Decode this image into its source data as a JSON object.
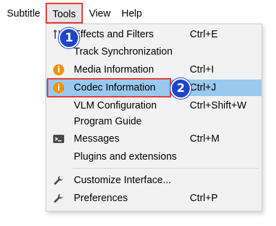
{
  "menubar": {
    "subtitle": "Subtitle",
    "tools": "Tools",
    "view": "View",
    "help": "Help"
  },
  "menu": {
    "effects": {
      "label": "Effects and Filters",
      "shortcut": "Ctrl+E"
    },
    "track_sync": {
      "label": "Track Synchronization"
    },
    "media_info": {
      "label": "Media Information",
      "shortcut": "Ctrl+I"
    },
    "codec_info": {
      "label": "Codec Information",
      "shortcut": "Ctrl+J"
    },
    "vlm": {
      "label": "VLM Configuration",
      "shortcut": "Ctrl+Shift+W"
    },
    "program_guide": {
      "label": "Program Guide"
    },
    "messages": {
      "label": "Messages",
      "shortcut": "Ctrl+M"
    },
    "plugins": {
      "label": "Plugins and extensions"
    },
    "customize": {
      "label": "Customize Interface..."
    },
    "preferences": {
      "label": "Preferences",
      "shortcut": "Ctrl+P"
    }
  },
  "info_glyph": "i",
  "badges": {
    "one": "1",
    "two": "2"
  },
  "colors": {
    "highlight": "#99c9ef",
    "info_icon": "#f39200",
    "annotation_box": "#e53935",
    "badge": "#1f45c8"
  }
}
